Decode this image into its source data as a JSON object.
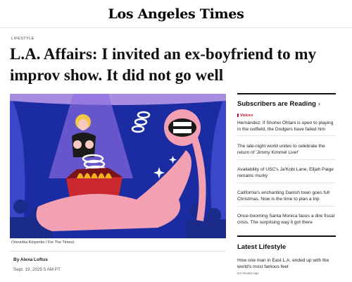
{
  "masthead": {
    "logo": "Los Angeles Times"
  },
  "article": {
    "section": "LIFESTYLE",
    "headline": "L.A. Affairs: I invited an ex-boyfriend to my improv show. It did not go well",
    "caption": "(Veronika Kiriyenko / For The Times)",
    "byline": "By Alexa Loftus",
    "date": "Sept. 19, 2025 5 AM PT"
  },
  "subscribers_reading": {
    "title": "Subscribers are Reading",
    "chevron": "›",
    "items": [
      {
        "kicker": "Voices",
        "text": "Hernández: If Shohei Ohtani is open to playing in the outfield, the Dodgers have failed him"
      },
      {
        "text": "The late-night world unites to celebrate the return of 'Jimmy Kimmel Live!'"
      },
      {
        "text": "Availability of USC's Ja'Kobi Lane, Elijah Paige remains murky"
      },
      {
        "text": "California's enchanting Danish town goes full Christmas. Now is the time to plan a trip"
      },
      {
        "text": "Once-booming Santa Monica faces a dire fiscal crisis. The surprising way it got there"
      }
    ]
  },
  "latest_lifestyle": {
    "title": "Latest Lifestyle",
    "items": [
      {
        "text": "How one man in East L.A. ended up with the world's most famous feet",
        "time": "54 minutes ago"
      }
    ]
  },
  "colors": {
    "rail_accent": "#c8102e",
    "art_background": "#1d2fa8"
  }
}
